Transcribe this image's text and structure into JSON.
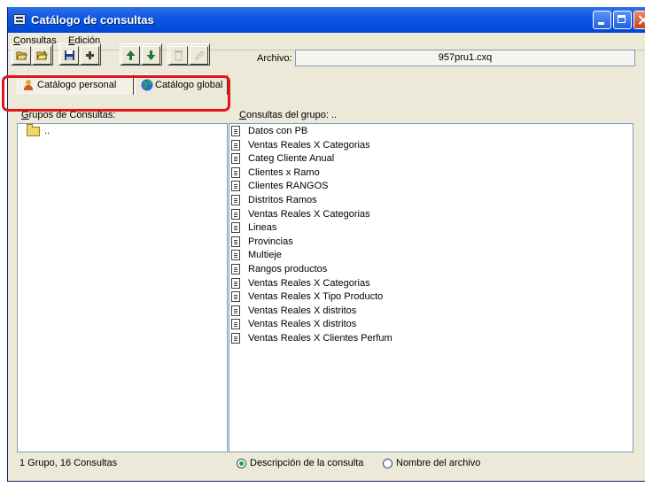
{
  "window": {
    "title": "Catálogo de consultas"
  },
  "menubar": [
    {
      "label_prefix": "",
      "underlined": "C",
      "rest": "onsultas"
    },
    {
      "label_prefix": "",
      "underlined": "E",
      "rest": "dición"
    }
  ],
  "toolbar": {
    "buttons": [
      {
        "icon": "open-folder-icon",
        "enabled": true
      },
      {
        "icon": "open-folder-alt-icon",
        "enabled": true
      },
      {
        "icon": "save-icon",
        "enabled": true
      },
      {
        "icon": "add-icon",
        "enabled": true
      },
      {
        "icon": "arrow-up-icon",
        "enabled": true
      },
      {
        "icon": "arrow-down-icon",
        "enabled": true
      },
      {
        "icon": "trash-icon",
        "enabled": false
      },
      {
        "icon": "edit-icon",
        "enabled": false
      }
    ]
  },
  "archivo": {
    "label": "Archivo:",
    "value": "957pru1.cxq"
  },
  "tabs": [
    {
      "label": "Catálogo personal",
      "icon": "person-icon",
      "active": true
    },
    {
      "label": "Catálogo global",
      "icon": "globe-icon",
      "active": false
    }
  ],
  "left_panel": {
    "header_ul": "G",
    "header_rest": "rupos de Consultas:",
    "items": [
      ".."
    ]
  },
  "right_panel": {
    "header_ul": "C",
    "header_rest": "onsultas del grupo: ..",
    "items": [
      "Datos con PB",
      "Ventas Reales X Categorias",
      "Categ Cliente Anual",
      "Clientes x Ramo",
      "Clientes RANGOS",
      "Distritos Ramos",
      "Ventas Reales X Categorias",
      "Lineas",
      "Provincias",
      "Multieje",
      "Rangos productos",
      "Ventas Reales X Categorias",
      "Ventas Reales X Tipo Producto",
      "Ventas Reales X distritos",
      "Ventas Reales X distritos",
      "Ventas Reales X Clientes Perfum"
    ]
  },
  "status": {
    "summary": "1 Grupo, 16 Consultas",
    "radio_options": [
      {
        "label": "Descripción de la consulta",
        "checked": true
      },
      {
        "label": "Nombre del archivo",
        "checked": false
      }
    ]
  },
  "colors": {
    "title_bar": "#0a56e2",
    "window_bg": "#ece9d8",
    "highlight": "#e2131b"
  }
}
